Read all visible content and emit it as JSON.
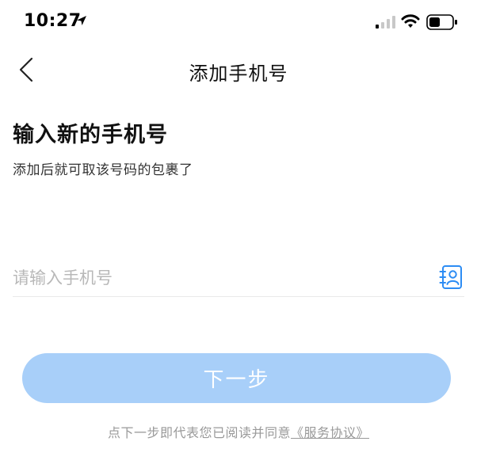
{
  "status_bar": {
    "time": "10:27"
  },
  "nav": {
    "title": "添加手机号"
  },
  "content": {
    "heading": "输入新的手机号",
    "subheading": "添加后就可取该号码的包裹了"
  },
  "phone_input": {
    "value": "",
    "placeholder": "请输入手机号"
  },
  "next_button": {
    "label": "下一步"
  },
  "agreement": {
    "prefix": "点下一步即代表您已阅读并同意",
    "link_text": "《服务协议》"
  },
  "colors": {
    "accent": "#2c8cf4",
    "button_disabled": "#a8cff9"
  }
}
